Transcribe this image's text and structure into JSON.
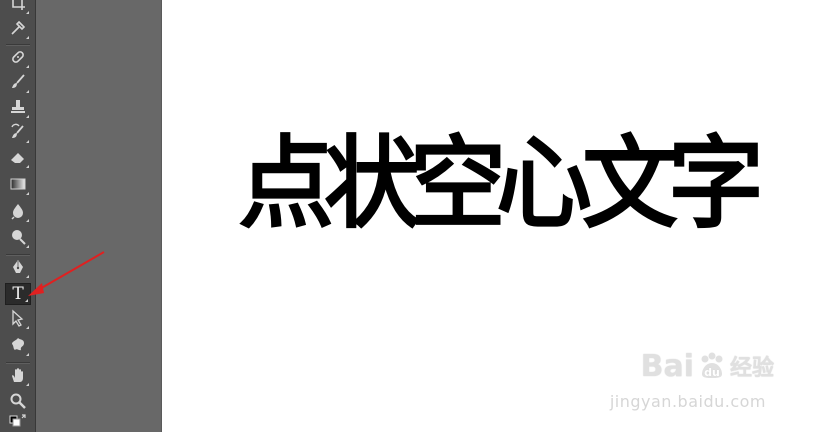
{
  "toolbar": {
    "tools": [
      {
        "name": "crop-icon",
        "label": "",
        "active": false
      },
      {
        "name": "eyedropper-icon",
        "label": "",
        "active": false
      },
      {
        "name": "healing-brush-icon",
        "label": "",
        "active": false
      },
      {
        "name": "brush-icon",
        "label": "",
        "active": false
      },
      {
        "name": "clone-stamp-icon",
        "label": "",
        "active": false
      },
      {
        "name": "history-brush-icon",
        "label": "",
        "active": false
      },
      {
        "name": "eraser-icon",
        "label": "",
        "active": false
      },
      {
        "name": "gradient-icon",
        "label": "",
        "active": false
      },
      {
        "name": "blur-icon",
        "label": "",
        "active": false
      },
      {
        "name": "dodge-icon",
        "label": "",
        "active": false
      },
      {
        "name": "pen-icon",
        "label": "",
        "active": false
      },
      {
        "name": "type-tool-icon",
        "label": "T",
        "active": true
      },
      {
        "name": "path-selection-icon",
        "label": "",
        "active": false
      },
      {
        "name": "custom-shape-icon",
        "label": "",
        "active": false
      },
      {
        "name": "hand-icon",
        "label": "",
        "active": false
      },
      {
        "name": "zoom-icon",
        "label": "",
        "active": false
      },
      {
        "name": "color-swatches-icon",
        "label": "",
        "active": false
      }
    ]
  },
  "canvas": {
    "headline_chars": [
      "点",
      "状",
      "空",
      "心",
      "文",
      "字"
    ]
  },
  "annotation": {
    "arrow_color": "#e02020"
  },
  "watermark": {
    "brand": "Bai",
    "brand_tail": "经验",
    "site": "jingyan.baidu.com"
  }
}
